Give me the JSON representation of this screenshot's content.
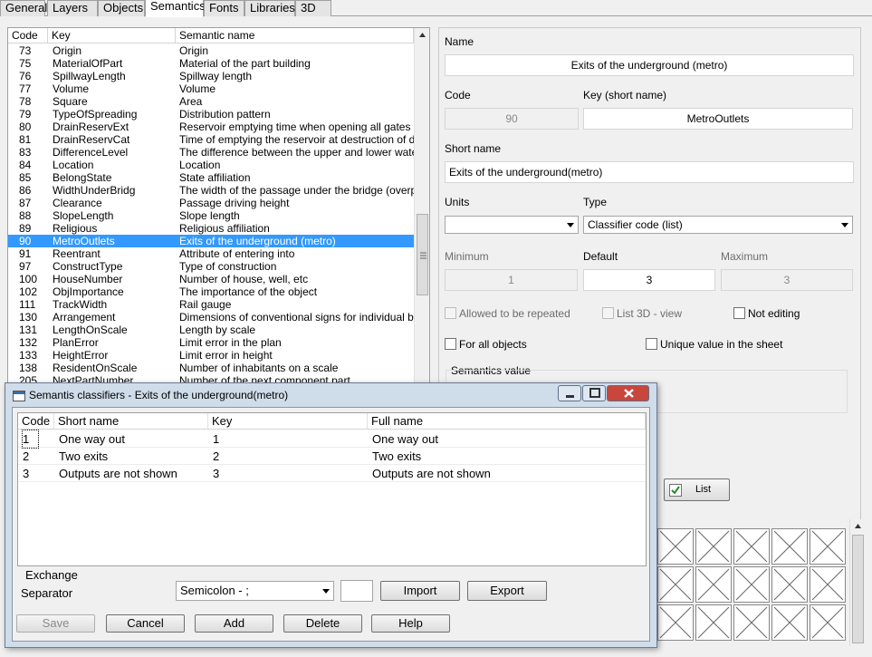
{
  "tabs": [
    "General",
    "Layers",
    "Objects",
    "Semantics",
    "Fonts",
    "Libraries",
    "3D"
  ],
  "active_tab": "Semantics",
  "table": {
    "headers": [
      "Code",
      "Key",
      "Semantic name"
    ],
    "rows": [
      [
        "73",
        "Origin",
        "Origin"
      ],
      [
        "75",
        "MaterialOfPart",
        "Material of the part building"
      ],
      [
        "76",
        "SpillwayLength",
        "Spillway length"
      ],
      [
        "77",
        "Volume",
        "Volume"
      ],
      [
        "78",
        "Square",
        "Area"
      ],
      [
        "79",
        "TypeOfSpreading",
        "Distribution pattern"
      ],
      [
        "80",
        "DrainReservExt",
        "Reservoir emptying time when opening all gates"
      ],
      [
        "81",
        "DrainReservCat",
        "Time of emptying the reservoir at destruction of da"
      ],
      [
        "83",
        "DifferenceLevel",
        "The difference between the upper and lower water"
      ],
      [
        "84",
        "Location",
        "Location"
      ],
      [
        "85",
        "BelongState",
        "State affiliation"
      ],
      [
        "86",
        "WidthUnderBridg",
        "The width of the passage under the bridge (overpa"
      ],
      [
        "87",
        "Clearance",
        "Passage driving height"
      ],
      [
        "88",
        "SlopeLength",
        "Slope length"
      ],
      [
        "89",
        "Religious",
        "Religious affiliation"
      ],
      [
        "90",
        "MetroOutlets",
        "Exits of the underground (metro)"
      ],
      [
        "91",
        "Reentrant",
        "Attribute of entering into"
      ],
      [
        "97",
        "ConstructType",
        "Type of construction"
      ],
      [
        "100",
        "HouseNumber",
        "Number of house, well, etc"
      ],
      [
        "102",
        "ObjImportance",
        "The importance of the object"
      ],
      [
        "111",
        "TrackWidth",
        "Rail gauge"
      ],
      [
        "130",
        "Arrangement",
        "Dimensions of conventional signs for individual bu"
      ],
      [
        "131",
        "LengthOnScale",
        "Length by scale"
      ],
      [
        "132",
        "PlanError",
        "Limit error in the plan"
      ],
      [
        "133",
        "HeightError",
        "Limit error in height"
      ],
      [
        "138",
        "ResidentOnScale",
        "Number of inhabitants on a scale"
      ],
      [
        "205",
        "NextPartNumber",
        "Number of the next component part"
      ]
    ],
    "selected_code": "90"
  },
  "details": {
    "name_label": "Name",
    "name_value": "Exits of the underground (metro)",
    "code_label": "Code",
    "code_value": "90",
    "key_label": "Key (short name)",
    "key_value": "MetroOutlets",
    "short_name_label": "Short name",
    "short_name_value": "Exits of the underground(metro)",
    "units_label": "Units",
    "units_value": "",
    "type_label": "Type",
    "type_value": "Classifier code (list)",
    "minimum_label": "Minimum",
    "minimum_value": "1",
    "default_label": "Default",
    "default_value": "3",
    "maximum_label": "Maximum",
    "maximum_value": "3",
    "allowed_repeated_label": "Allowed to be repeated",
    "list3d_label": "List 3D - view",
    "not_editing_label": "Not editing",
    "for_all_objects_label": "For all objects",
    "unique_value_label": "Unique value in the sheet",
    "semantics_value_label": "Semantics value",
    "list_button_label": "List"
  },
  "dialog": {
    "title": "Semantis classifiers - Exits of the underground(metro)",
    "headers": [
      "Code",
      "Short name",
      "Key",
      "Full name"
    ],
    "rows": [
      [
        "1",
        "One way out",
        "1",
        "One way out"
      ],
      [
        "2",
        "Two exits",
        "2",
        "Two exits"
      ],
      [
        "3",
        "Outputs are not shown",
        "3",
        "Outputs are not shown"
      ]
    ],
    "exchange_label": "Exchange",
    "separator_label": "Separator",
    "separator_value": "Semicolon - ;",
    "import_label": "Import",
    "export_label": "Export",
    "save_label": "Save",
    "cancel_label": "Cancel",
    "add_label": "Add",
    "delete_label": "Delete",
    "help_label": "Help"
  },
  "colors": {
    "selection": "#3399ff",
    "window_bg": "#f0f0f0",
    "dialog_frame": "#cfdcea",
    "close_button": "#c9463d"
  }
}
